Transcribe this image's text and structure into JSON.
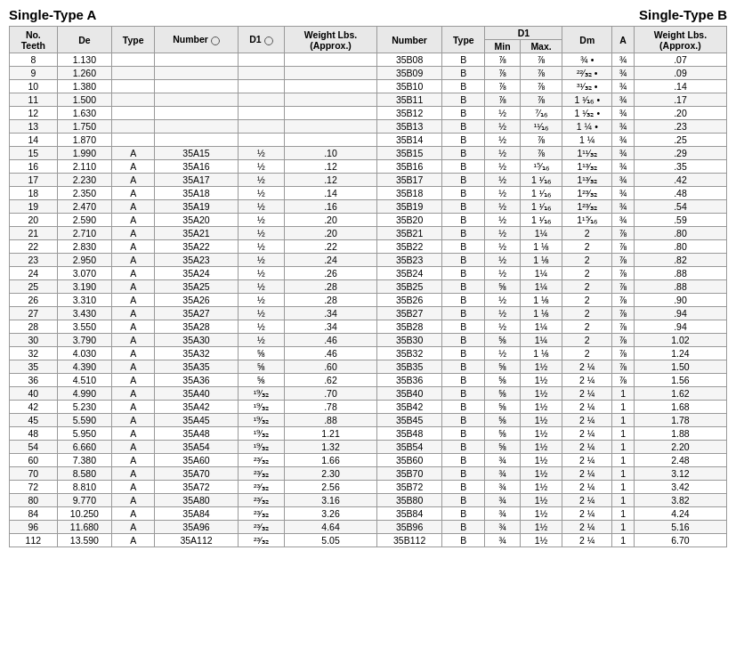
{
  "titles": {
    "left": "Single-Type A",
    "right": "Single-Type B"
  },
  "columns": {
    "left_section": [
      "No.\nTeeth",
      "De",
      "Type",
      "Number",
      "D1",
      "Weight Lbs.\n(Approx.)"
    ],
    "right_section": [
      "Number",
      "Type",
      "D1_Min",
      "D1_Max",
      "Dm",
      "A",
      "Weight Lbs.\n(Approx.)"
    ]
  },
  "rows": [
    {
      "teeth": 8,
      "de": "1.130",
      "type_a": "",
      "num_a": "",
      "d1_a": "",
      "wt_a": "",
      "num_b": "35B08",
      "type_b": "B",
      "d1min": "⅞",
      "d1max": "⅞",
      "dm": "¾ •",
      "a_b": "¾",
      "wt_b": ".07"
    },
    {
      "teeth": 9,
      "de": "1.260",
      "type_a": "",
      "num_a": "",
      "d1_a": "",
      "wt_a": "",
      "num_b": "35B09",
      "type_b": "B",
      "d1min": "⅞",
      "d1max": "⅞",
      "dm": "²²∕₃₂ •",
      "a_b": "¾",
      "wt_b": ".09"
    },
    {
      "teeth": 10,
      "de": "1.380",
      "type_a": "",
      "num_a": "",
      "d1_a": "",
      "wt_a": "",
      "num_b": "35B10",
      "type_b": "B",
      "d1min": "⅞",
      "d1max": "⅞",
      "dm": "³¹∕₃₂ •",
      "a_b": "¾",
      "wt_b": ".14"
    },
    {
      "teeth": 11,
      "de": "1.500",
      "type_a": "",
      "num_a": "",
      "d1_a": "",
      "wt_a": "",
      "num_b": "35B11",
      "type_b": "B",
      "d1min": "⅞",
      "d1max": "⅞",
      "dm": "1 ¹∕₁₆ •",
      "a_b": "¾",
      "wt_b": ".17"
    },
    {
      "teeth": 12,
      "de": "1.630",
      "type_a": "",
      "num_a": "",
      "d1_a": "",
      "wt_a": "",
      "num_b": "35B12",
      "type_b": "B",
      "d1min": "½",
      "d1max": "⁷∕₁₆",
      "dm": "1 ¹∕₃₂ •",
      "a_b": "¾",
      "wt_b": ".20"
    },
    {
      "teeth": 13,
      "de": "1.750",
      "type_a": "",
      "num_a": "",
      "d1_a": "",
      "wt_a": "",
      "num_b": "35B13",
      "type_b": "B",
      "d1min": "½",
      "d1max": "¹¹∕₁₆",
      "dm": "1 ¼ •",
      "a_b": "¾",
      "wt_b": ".23"
    },
    {
      "teeth": 14,
      "de": "1.870",
      "type_a": "",
      "num_a": "",
      "d1_a": "",
      "wt_a": "",
      "num_b": "35B14",
      "type_b": "B",
      "d1min": "½",
      "d1max": "⅞",
      "dm": "1 ¼",
      "a_b": "¾",
      "wt_b": ".25"
    },
    {
      "teeth": 15,
      "de": "1.990",
      "type_a": "A",
      "num_a": "35A15",
      "d1_a": "½",
      "wt_a": ".10",
      "num_b": "35B15",
      "type_b": "B",
      "d1min": "½",
      "d1max": "⅞",
      "dm": "1¹¹∕₃₂",
      "a_b": "¾",
      "wt_b": ".29"
    },
    {
      "teeth": 16,
      "de": "2.110",
      "type_a": "A",
      "num_a": "35A16",
      "d1_a": "½",
      "wt_a": ".12",
      "num_b": "35B16",
      "type_b": "B",
      "d1min": "½",
      "d1max": "¹⁵∕₁₆",
      "dm": "1¹³∕₃₂",
      "a_b": "¾",
      "wt_b": ".35"
    },
    {
      "teeth": 17,
      "de": "2.230",
      "type_a": "A",
      "num_a": "35A17",
      "d1_a": "½",
      "wt_a": ".12",
      "num_b": "35B17",
      "type_b": "B",
      "d1min": "½",
      "d1max": "1 ¹∕₁₆",
      "dm": "1¹³∕₃₂",
      "a_b": "¾",
      "wt_b": ".42"
    },
    {
      "teeth": 18,
      "de": "2.350",
      "type_a": "A",
      "num_a": "35A18",
      "d1_a": "½",
      "wt_a": ".14",
      "num_b": "35B18",
      "type_b": "B",
      "d1min": "½",
      "d1max": "1 ¹∕₁₆",
      "dm": "1²³∕₃₂",
      "a_b": "¾",
      "wt_b": ".48"
    },
    {
      "teeth": 19,
      "de": "2.470",
      "type_a": "A",
      "num_a": "35A19",
      "d1_a": "½",
      "wt_a": ".16",
      "num_b": "35B19",
      "type_b": "B",
      "d1min": "½",
      "d1max": "1 ¹∕₁₆",
      "dm": "1²³∕₃₂",
      "a_b": "¾",
      "wt_b": ".54"
    },
    {
      "teeth": 20,
      "de": "2.590",
      "type_a": "A",
      "num_a": "35A20",
      "d1_a": "½",
      "wt_a": ".20",
      "num_b": "35B20",
      "type_b": "B",
      "d1min": "½",
      "d1max": "1 ¹∕₁₆",
      "dm": "1¹⁵∕₁₆",
      "a_b": "¾",
      "wt_b": ".59"
    },
    {
      "teeth": 21,
      "de": "2.710",
      "type_a": "A",
      "num_a": "35A21",
      "d1_a": "½",
      "wt_a": ".20",
      "num_b": "35B21",
      "type_b": "B",
      "d1min": "½",
      "d1max": "1¼",
      "dm": "2",
      "a_b": "⅞",
      "wt_b": ".80"
    },
    {
      "teeth": 22,
      "de": "2.830",
      "type_a": "A",
      "num_a": "35A22",
      "d1_a": "½",
      "wt_a": ".22",
      "num_b": "35B22",
      "type_b": "B",
      "d1min": "½",
      "d1max": "1 ⅛",
      "dm": "2",
      "a_b": "⅞",
      "wt_b": ".80"
    },
    {
      "teeth": 23,
      "de": "2.950",
      "type_a": "A",
      "num_a": "35A23",
      "d1_a": "½",
      "wt_a": ".24",
      "num_b": "35B23",
      "type_b": "B",
      "d1min": "½",
      "d1max": "1 ⅛",
      "dm": "2",
      "a_b": "⅞",
      "wt_b": ".82"
    },
    {
      "teeth": 24,
      "de": "3.070",
      "type_a": "A",
      "num_a": "35A24",
      "d1_a": "½",
      "wt_a": ".26",
      "num_b": "35B24",
      "type_b": "B",
      "d1min": "½",
      "d1max": "1¼",
      "dm": "2",
      "a_b": "⅞",
      "wt_b": ".88"
    },
    {
      "teeth": 25,
      "de": "3.190",
      "type_a": "A",
      "num_a": "35A25",
      "d1_a": "½",
      "wt_a": ".28",
      "num_b": "35B25",
      "type_b": "B",
      "d1min": "⅝",
      "d1max": "1¼",
      "dm": "2",
      "a_b": "⅞",
      "wt_b": ".88"
    },
    {
      "teeth": 26,
      "de": "3.310",
      "type_a": "A",
      "num_a": "35A26",
      "d1_a": "½",
      "wt_a": ".28",
      "num_b": "35B26",
      "type_b": "B",
      "d1min": "½",
      "d1max": "1 ⅛",
      "dm": "2",
      "a_b": "⅞",
      "wt_b": ".90"
    },
    {
      "teeth": 27,
      "de": "3.430",
      "type_a": "A",
      "num_a": "35A27",
      "d1_a": "½",
      "wt_a": ".34",
      "num_b": "35B27",
      "type_b": "B",
      "d1min": "½",
      "d1max": "1 ⅛",
      "dm": "2",
      "a_b": "⅞",
      "wt_b": ".94"
    },
    {
      "teeth": 28,
      "de": "3.550",
      "type_a": "A",
      "num_a": "35A28",
      "d1_a": "½",
      "wt_a": ".34",
      "num_b": "35B28",
      "type_b": "B",
      "d1min": "½",
      "d1max": "1¼",
      "dm": "2",
      "a_b": "⅞",
      "wt_b": ".94"
    },
    {
      "teeth": 30,
      "de": "3.790",
      "type_a": "A",
      "num_a": "35A30",
      "d1_a": "½",
      "wt_a": ".46",
      "num_b": "35B30",
      "type_b": "B",
      "d1min": "⅝",
      "d1max": "1¼",
      "dm": "2",
      "a_b": "⅞",
      "wt_b": "1.02"
    },
    {
      "teeth": 32,
      "de": "4.030",
      "type_a": "A",
      "num_a": "35A32",
      "d1_a": "⅝",
      "wt_a": ".46",
      "num_b": "35B32",
      "type_b": "B",
      "d1min": "½",
      "d1max": "1 ⅛",
      "dm": "2",
      "a_b": "⅞",
      "wt_b": "1.24"
    },
    {
      "teeth": 35,
      "de": "4.390",
      "type_a": "A",
      "num_a": "35A35",
      "d1_a": "⅝",
      "wt_a": ".60",
      "num_b": "35B35",
      "type_b": "B",
      "d1min": "⅝",
      "d1max": "1½",
      "dm": "2 ¼",
      "a_b": "⅞",
      "wt_b": "1.50"
    },
    {
      "teeth": 36,
      "de": "4.510",
      "type_a": "A",
      "num_a": "35A36",
      "d1_a": "⅝",
      "wt_a": ".62",
      "num_b": "35B36",
      "type_b": "B",
      "d1min": "⅝",
      "d1max": "1½",
      "dm": "2 ¼",
      "a_b": "⅞",
      "wt_b": "1.56"
    },
    {
      "teeth": 40,
      "de": "4.990",
      "type_a": "A",
      "num_a": "35A40",
      "d1_a": "¹⁹∕₃₂",
      "wt_a": ".70",
      "num_b": "35B40",
      "type_b": "B",
      "d1min": "⅝",
      "d1max": "1½",
      "dm": "2 ¼",
      "a_b": "1",
      "wt_b": "1.62"
    },
    {
      "teeth": 42,
      "de": "5.230",
      "type_a": "A",
      "num_a": "35A42",
      "d1_a": "¹⁹∕₃₂",
      "wt_a": ".78",
      "num_b": "35B42",
      "type_b": "B",
      "d1min": "⅝",
      "d1max": "1½",
      "dm": "2 ¼",
      "a_b": "1",
      "wt_b": "1.68"
    },
    {
      "teeth": 45,
      "de": "5.590",
      "type_a": "A",
      "num_a": "35A45",
      "d1_a": "¹⁹∕₃₂",
      "wt_a": ".88",
      "num_b": "35B45",
      "type_b": "B",
      "d1min": "⅝",
      "d1max": "1½",
      "dm": "2 ¼",
      "a_b": "1",
      "wt_b": "1.78"
    },
    {
      "teeth": 48,
      "de": "5.950",
      "type_a": "A",
      "num_a": "35A48",
      "d1_a": "¹⁹∕₃₂",
      "wt_a": "1.21",
      "num_b": "35B48",
      "type_b": "B",
      "d1min": "⅝",
      "d1max": "1½",
      "dm": "2 ¼",
      "a_b": "1",
      "wt_b": "1.88"
    },
    {
      "teeth": 54,
      "de": "6.660",
      "type_a": "A",
      "num_a": "35A54",
      "d1_a": "¹⁹∕₃₂",
      "wt_a": "1.32",
      "num_b": "35B54",
      "type_b": "B",
      "d1min": "⅝",
      "d1max": "1½",
      "dm": "2 ¼",
      "a_b": "1",
      "wt_b": "2.20"
    },
    {
      "teeth": 60,
      "de": "7.380",
      "type_a": "A",
      "num_a": "35A60",
      "d1_a": "²³∕₃₂",
      "wt_a": "1.66",
      "num_b": "35B60",
      "type_b": "B",
      "d1min": "¾",
      "d1max": "1½",
      "dm": "2 ¼",
      "a_b": "1",
      "wt_b": "2.48"
    },
    {
      "teeth": 70,
      "de": "8.580",
      "type_a": "A",
      "num_a": "35A70",
      "d1_a": "²³∕₃₂",
      "wt_a": "2.30",
      "num_b": "35B70",
      "type_b": "B",
      "d1min": "¾",
      "d1max": "1½",
      "dm": "2 ¼",
      "a_b": "1",
      "wt_b": "3.12"
    },
    {
      "teeth": 72,
      "de": "8.810",
      "type_a": "A",
      "num_a": "35A72",
      "d1_a": "²³∕₃₂",
      "wt_a": "2.56",
      "num_b": "35B72",
      "type_b": "B",
      "d1min": "¾",
      "d1max": "1½",
      "dm": "2 ¼",
      "a_b": "1",
      "wt_b": "3.42"
    },
    {
      "teeth": 80,
      "de": "9.770",
      "type_a": "A",
      "num_a": "35A80",
      "d1_a": "²³∕₃₂",
      "wt_a": "3.16",
      "num_b": "35B80",
      "type_b": "B",
      "d1min": "¾",
      "d1max": "1½",
      "dm": "2 ¼",
      "a_b": "1",
      "wt_b": "3.82"
    },
    {
      "teeth": 84,
      "de": "10.250",
      "type_a": "A",
      "num_a": "35A84",
      "d1_a": "²³∕₃₂",
      "wt_a": "3.26",
      "num_b": "35B84",
      "type_b": "B",
      "d1min": "¾",
      "d1max": "1½",
      "dm": "2 ¼",
      "a_b": "1",
      "wt_b": "4.24"
    },
    {
      "teeth": 96,
      "de": "11.680",
      "type_a": "A",
      "num_a": "35A96",
      "d1_a": "²³∕₃₂",
      "wt_a": "4.64",
      "num_b": "35B96",
      "type_b": "B",
      "d1min": "¾",
      "d1max": "1½",
      "dm": "2 ¼",
      "a_b": "1",
      "wt_b": "5.16"
    },
    {
      "teeth": 112,
      "de": "13.590",
      "type_a": "A",
      "num_a": "35A112",
      "d1_a": "²³∕₃₂",
      "wt_a": "5.05",
      "num_b": "35B112",
      "type_b": "B",
      "d1min": "¾",
      "d1max": "1½",
      "dm": "2 ¼",
      "a_b": "1",
      "wt_b": "6.70"
    }
  ]
}
